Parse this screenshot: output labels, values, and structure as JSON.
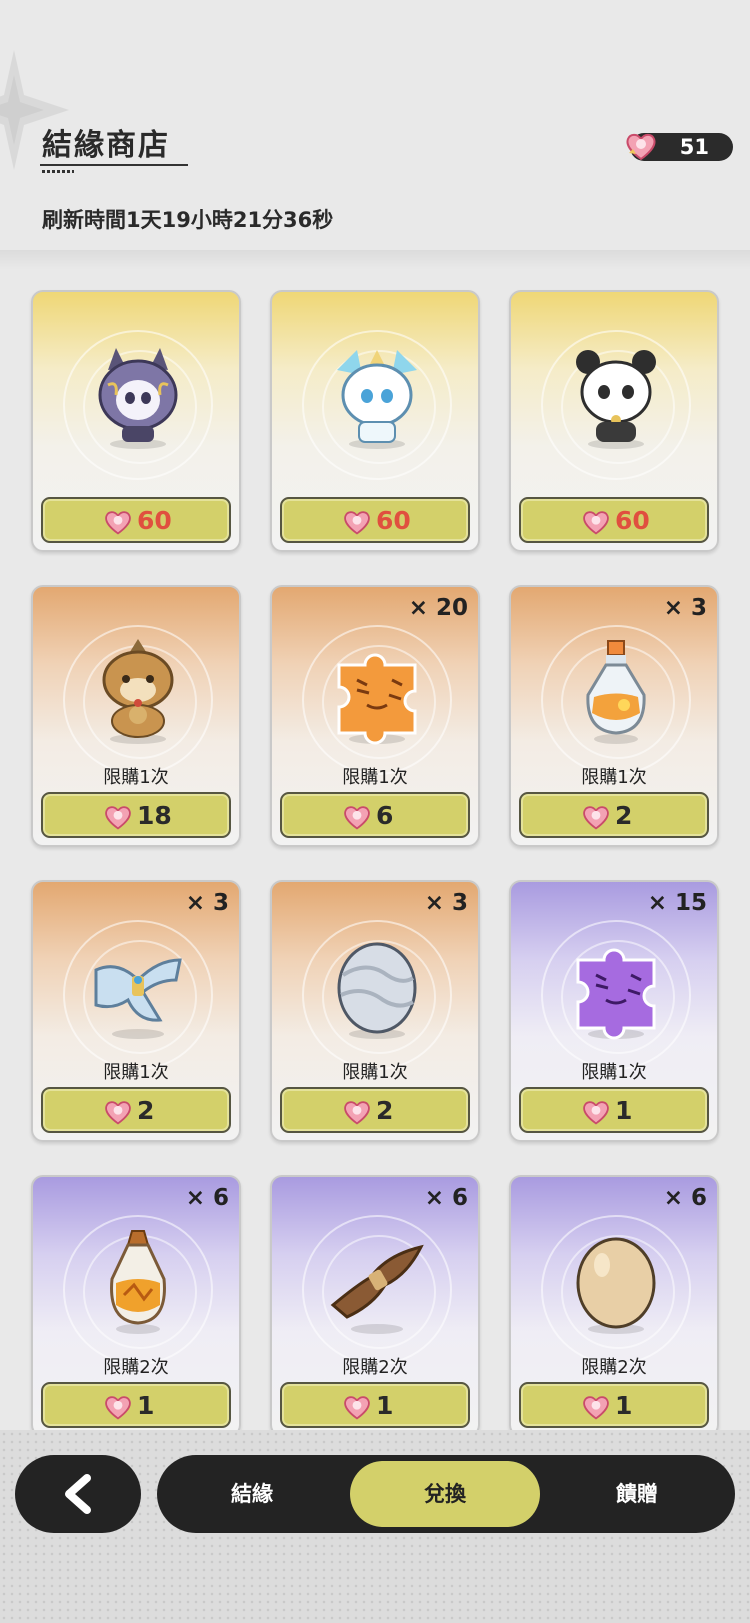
{
  "header": {
    "title": "結緣商店",
    "refresh_text": "刷新時間1天19小時21分36秒",
    "currency_icon": "heart-gem-icon",
    "currency_count": "51"
  },
  "items": [
    {
      "name": "purple-wolf-pet",
      "qty": "",
      "limit": "",
      "price": "60",
      "theme": "gold"
    },
    {
      "name": "crystal-fox-pet",
      "qty": "",
      "limit": "",
      "price": "60",
      "theme": "gold"
    },
    {
      "name": "panda-cat-pet",
      "qty": "",
      "limit": "",
      "price": "60",
      "theme": "gold"
    },
    {
      "name": "lion-dog-pet",
      "qty": "",
      "limit": "限購1次",
      "price": "18",
      "theme": "orange"
    },
    {
      "name": "orange-tiger-puzzle-piece",
      "qty": "× 20",
      "limit": "限購1次",
      "price": "6",
      "theme": "orange"
    },
    {
      "name": "orange-potion-bottle",
      "qty": "× 3",
      "limit": "限購1次",
      "price": "2",
      "theme": "orange"
    },
    {
      "name": "blue-scroll-bundle",
      "qty": "× 3",
      "limit": "限購1次",
      "price": "2",
      "theme": "orange"
    },
    {
      "name": "silver-egg",
      "qty": "× 3",
      "limit": "限購1次",
      "price": "2",
      "theme": "orange"
    },
    {
      "name": "purple-tiger-puzzle-piece",
      "qty": "× 15",
      "limit": "限購1次",
      "price": "1",
      "theme": "purple"
    },
    {
      "name": "amber-potion-bottle",
      "qty": "× 6",
      "limit": "限購2次",
      "price": "1",
      "theme": "purple"
    },
    {
      "name": "brown-feather-bundle",
      "qty": "× 6",
      "limit": "限購2次",
      "price": "1",
      "theme": "purple"
    },
    {
      "name": "plain-egg",
      "qty": "× 6",
      "limit": "限購2次",
      "price": "1",
      "theme": "purple"
    }
  ],
  "tabs": [
    {
      "label": "結緣",
      "active": false
    },
    {
      "label": "兌換",
      "active": true
    },
    {
      "label": "饋贈",
      "active": false
    }
  ],
  "colors": {
    "accent": "#d3d06a",
    "price_red": "#e04f3f",
    "dark": "#232323"
  }
}
